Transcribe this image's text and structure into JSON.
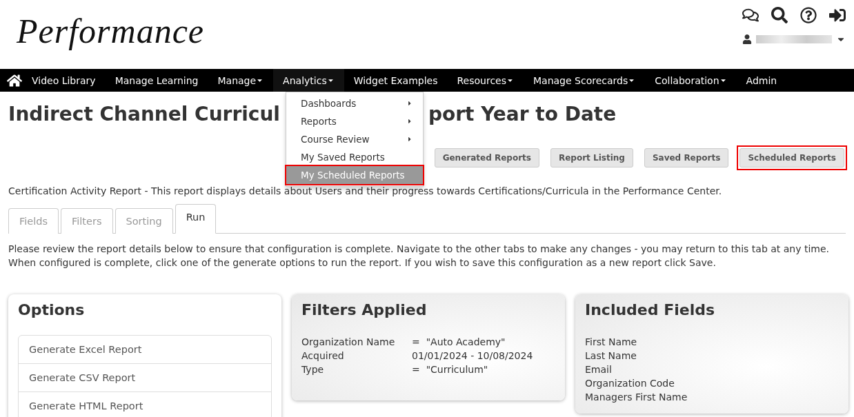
{
  "logo": "Performance",
  "nav": {
    "items": [
      {
        "label": "Video Library",
        "dropdown": false,
        "selected": false
      },
      {
        "label": "Manage Learning",
        "dropdown": false,
        "selected": false
      },
      {
        "label": "Manage",
        "dropdown": true,
        "selected": false
      },
      {
        "label": "Analytics",
        "dropdown": true,
        "selected": true
      },
      {
        "label": "Widget Examples",
        "dropdown": false,
        "selected": false
      },
      {
        "label": "Resources",
        "dropdown": true,
        "selected": false
      },
      {
        "label": "Manage Scorecards",
        "dropdown": true,
        "selected": false
      },
      {
        "label": "Collaboration",
        "dropdown": true,
        "selected": false
      },
      {
        "label": "Admin",
        "dropdown": false,
        "selected": false
      }
    ]
  },
  "analytics_menu": [
    {
      "label": "Dashboards",
      "submenu": true,
      "selected": false
    },
    {
      "label": "Reports",
      "submenu": true,
      "selected": false
    },
    {
      "label": "Course Review",
      "submenu": true,
      "selected": false
    },
    {
      "label": "My Saved Reports",
      "submenu": false,
      "selected": false
    },
    {
      "label": "My Scheduled Reports",
      "submenu": false,
      "selected": true
    }
  ],
  "page_title": [
    "Indirect Channel Curricul",
    "port Year to Date"
  ],
  "report_buttons": [
    {
      "label": "Generated Reports",
      "highlighted": false
    },
    {
      "label": "Report Listing",
      "highlighted": false
    },
    {
      "label": "Saved Reports",
      "highlighted": false
    },
    {
      "label": "Scheduled Reports",
      "highlighted": true
    }
  ],
  "description": "Certification Activity Report - This report displays details about Users and their progress towards Certifications/Curricula in the Performance Center.",
  "tabs": [
    {
      "label": "Fields",
      "selected": false
    },
    {
      "label": "Filters",
      "selected": false
    },
    {
      "label": "Sorting",
      "selected": false
    },
    {
      "label": "Run",
      "selected": true
    }
  ],
  "instructions": "Please review the report details below to ensure that configuration is complete. Navigate to the other tabs to make any changes - you may return to this tab at any time. When configured is complete, click one of the generate options to run the report. If you wish to save this configuration as a new report click Save.",
  "options": {
    "title": "Options",
    "items": [
      "Generate Excel Report",
      "Generate CSV Report",
      "Generate HTML Report"
    ]
  },
  "filters": {
    "title": "Filters Applied",
    "rows": [
      {
        "name": "Organization Name",
        "value": "=  \"Auto Academy\""
      },
      {
        "name": "Acquired",
        "value": "01/01/2024 - 10/08/2024"
      },
      {
        "name": "Type",
        "value": "=  \"Curriculum\""
      }
    ]
  },
  "included_fields": {
    "title": "Included Fields",
    "items": [
      "First Name",
      "Last Name",
      "Email",
      "Organization Code",
      "Managers First Name"
    ]
  }
}
